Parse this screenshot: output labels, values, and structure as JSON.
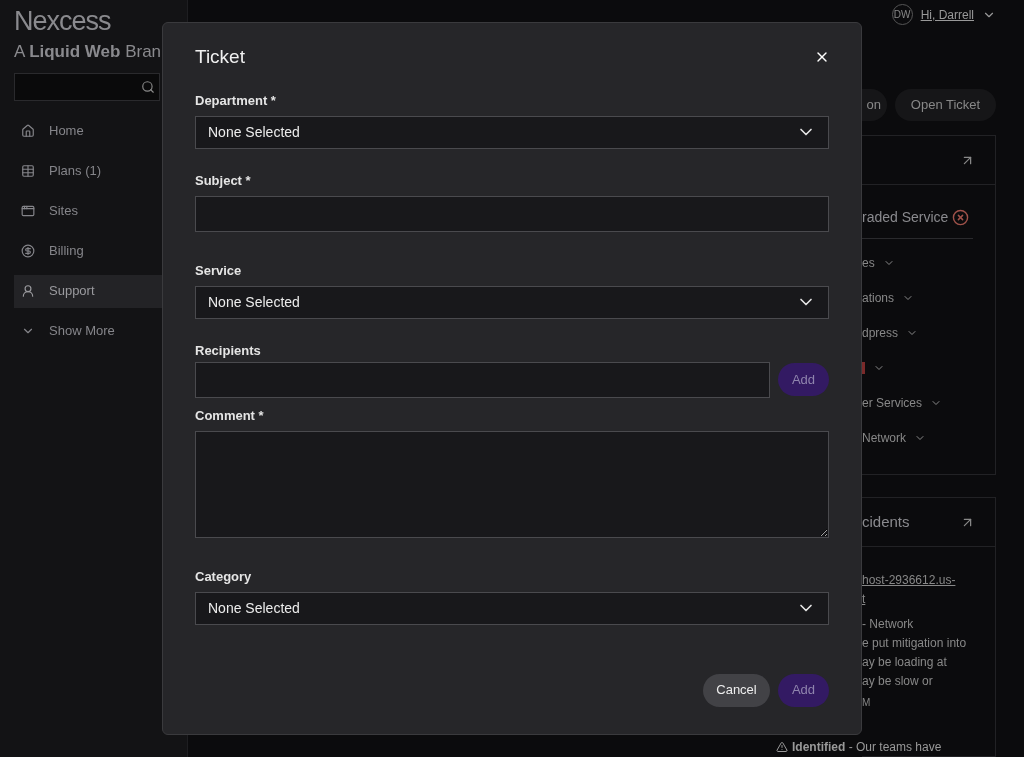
{
  "brand": {
    "logo": "Nexcess",
    "tagline": "A **Liquid Web** Bran"
  },
  "nav": [
    {
      "kind": "home",
      "label": "Home",
      "selected": false
    },
    {
      "kind": "plans",
      "label": "Plans (1)",
      "selected": false
    },
    {
      "kind": "sites",
      "label": "Sites",
      "selected": false
    },
    {
      "kind": "billing",
      "label": "Billing",
      "selected": false
    },
    {
      "kind": "support",
      "label": "Support",
      "selected": true
    },
    {
      "kind": "more",
      "label": "Show More",
      "selected": false
    }
  ],
  "user": {
    "initials": "DW",
    "greeting": "Hi, Darrell"
  },
  "actions": [
    "on",
    "Open Ticket"
  ],
  "status_panel": {
    "title": "raded Service",
    "items": [
      {
        "kind": "group",
        "label": "es"
      },
      {
        "kind": "group",
        "label": "ations"
      },
      {
        "kind": "group",
        "label": "dpress"
      },
      {
        "kind": "alert"
      },
      {
        "kind": "group",
        "label": "er Services"
      },
      {
        "kind": "group",
        "label": "Network"
      }
    ]
  },
  "incidents_panel": {
    "title": "cidents",
    "link_lines": [
      "host-2936612.us-",
      "t"
    ],
    "body_lines": [
      "- Network",
      "e put mitigation into",
      "ay be loading at",
      "ay be slow or"
    ],
    "time": "M",
    "update": "**Identified** - Our teams have"
  },
  "modal": {
    "title": "Ticket",
    "fields": [
      {
        "kind": "select",
        "label": "Department *",
        "value": "None Selected"
      },
      {
        "kind": "text",
        "label": "Subject *"
      },
      {
        "kind": "select",
        "label": "Service",
        "value": "None Selected"
      },
      {
        "kind": "text_add",
        "label": "Recipients",
        "button": "Add"
      },
      {
        "kind": "textarea",
        "label": "Comment *"
      },
      {
        "kind": "select",
        "label": "Category",
        "value": "None Selected"
      }
    ],
    "buttons": [
      {
        "kind": "secondary",
        "label": "Cancel"
      },
      {
        "kind": "primary",
        "label": "Add"
      }
    ]
  }
}
